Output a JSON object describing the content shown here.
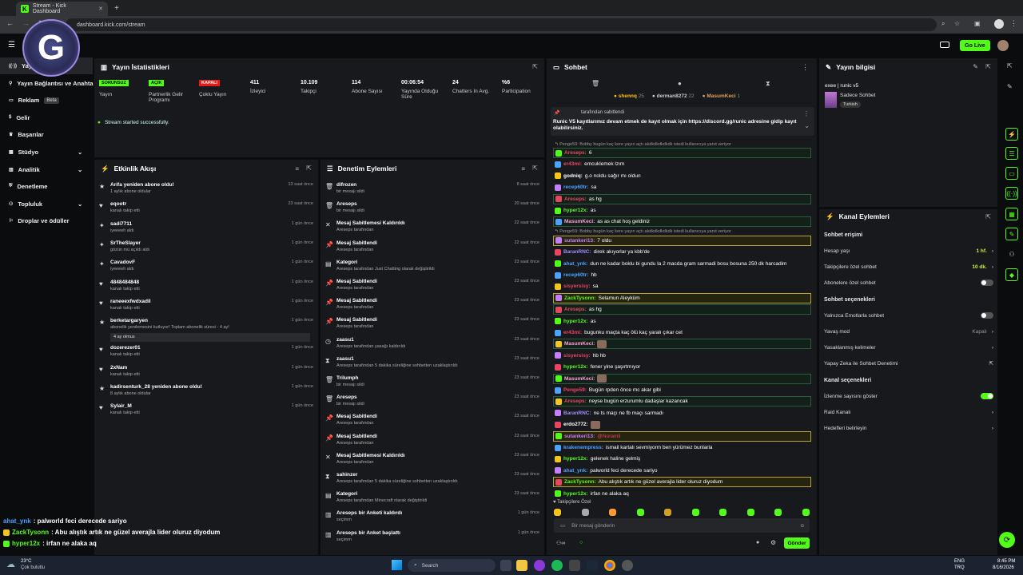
{
  "browser": {
    "tab_title": "Stream - Kick Dashboard",
    "url": "dashboard.kick.com/stream"
  },
  "app": {
    "go_live": "Go Live"
  },
  "nav": {
    "items": [
      {
        "label": "Yayın",
        "icon": "broadcast-icon"
      },
      {
        "label": "Yayın Bağlantısı ve Anahtarı",
        "icon": "link-icon"
      },
      {
        "label": "Reklam",
        "icon": "ad-icon",
        "badge": "Beta"
      },
      {
        "label": "Gelir",
        "icon": "dollar-icon"
      },
      {
        "label": "Başarılar",
        "icon": "trophy-icon"
      },
      {
        "label": "Stüdyo",
        "icon": "studio-icon"
      },
      {
        "label": "Analitik",
        "icon": "chart-icon"
      },
      {
        "label": "Denetleme",
        "icon": "shield-icon"
      },
      {
        "label": "Topluluk",
        "icon": "community-icon"
      },
      {
        "label": "Droplar ve ödüller",
        "icon": "gift-icon"
      }
    ]
  },
  "stats": {
    "title": "Yayın İstatistikleri",
    "items": [
      {
        "pill": "SORUNSUZ",
        "pill_color": "#53fc18",
        "label": "Yayın"
      },
      {
        "pill": "AÇIK",
        "pill_color": "#53fc18",
        "label": "Partnerlik Gelir Programı"
      },
      {
        "pill": "KAPALI",
        "pill_color": "#e91916",
        "label": "Çoklu Yayın"
      },
      {
        "value": "411",
        "label": "İzleyici"
      },
      {
        "value": "10.109",
        "label": "Takipçi"
      },
      {
        "value": "114",
        "label": "Abone Sayısı"
      },
      {
        "value": "00:06:54",
        "label": "Yayında Olduğu Süre"
      },
      {
        "value": "24",
        "label": "Chatters In Avg."
      },
      {
        "value": "%6",
        "label": "Participation"
      }
    ],
    "success": "Stream started successfully."
  },
  "activity": {
    "title": "Etkinlik Akışı",
    "events": [
      {
        "t": "Arifa yeniden abone oldu!",
        "s": "1 aylık abone oldular",
        "d": "13 saat önce",
        "icon": "★"
      },
      {
        "t": "eqootr",
        "s": "kanalı takip etti",
        "d": "23 saat önce",
        "icon": "♥"
      },
      {
        "t": "sadi7711",
        "s": "iyeeeeh aldı",
        "d": "1 gün önce",
        "icon": "✦"
      },
      {
        "t": "SrTheSlayer",
        "s": "gözün mü açıldı aldı",
        "d": "1 gün önce",
        "icon": "✦"
      },
      {
        "t": "CavadovF",
        "s": "iyeeeeh aldı",
        "d": "1 gün önce",
        "icon": "✦"
      },
      {
        "t": "4848484848",
        "s": "kanalı takip etti",
        "d": "1 gün önce",
        "icon": "♥"
      },
      {
        "t": "raneeexfwdxadil",
        "s": "kanalı takip etti",
        "d": "1 gün önce",
        "icon": "♥"
      },
      {
        "t": "berketargaryen",
        "s": "abonelik yenilemesini kutluyor! Toplam abonelik süresi - 4 ay!",
        "s2": "4 ay olmus",
        "d": "1 gün önce",
        "icon": "★"
      },
      {
        "t": "dozerezer01",
        "s": "kanalı takip etti",
        "d": "1 gün önce",
        "icon": "♥"
      },
      {
        "t": "2xNam",
        "s": "kanalı takip etti",
        "d": "1 gün önce",
        "icon": "♥"
      },
      {
        "t": "kadirsenturk_28 yeniden abone oldu!",
        "s": "8 aylık abone oldular",
        "d": "1 gün önce",
        "icon": "★"
      },
      {
        "t": "Sylair_M",
        "s": "kanalı takip etti",
        "d": "1 gün önce",
        "icon": "♥"
      }
    ]
  },
  "mod": {
    "title": "Denetim Eylemleri",
    "events": [
      {
        "t": "difrozen",
        "s": "bir mesajı sildi",
        "d": "8 saat önce",
        "icon": "🗑"
      },
      {
        "t": "Areseps",
        "s": "bir mesajı sildi",
        "d": "20 saat önce",
        "icon": "🗑"
      },
      {
        "t": "Mesaj Sabitlemesi Kaldırıldı",
        "s": "Areseps tarafından",
        "d": "22 saat önce",
        "icon": "✕"
      },
      {
        "t": "Mesaj Sabitlendi",
        "s": "Areseps tarafından",
        "d": "22 saat önce",
        "icon": "📌"
      },
      {
        "t": "Kategori",
        "s": "Areseps tarafından Just Chatting olarak değiştirildi",
        "d": "23 saat önce",
        "icon": "▤"
      },
      {
        "t": "Mesaj Sabitlendi",
        "s": "Areseps tarafından",
        "d": "23 saat önce",
        "icon": "📌"
      },
      {
        "t": "Mesaj Sabitlendi",
        "s": "Areseps tarafından",
        "d": "23 saat önce",
        "icon": "📌"
      },
      {
        "t": "Mesaj Sabitlendi",
        "s": "Areseps tarafından",
        "d": "23 saat önce",
        "icon": "📌"
      },
      {
        "t": "zaasu1",
        "s": "Areseps tarafından yasağı kaldırıldı",
        "d": "23 saat önce",
        "icon": "◷"
      },
      {
        "t": "zaasu1",
        "s": "Areseps tarafından 5 dakika süreliğine sohbetten uzaklaştırıldı",
        "d": "23 saat önce",
        "icon": "⧗"
      },
      {
        "t": "Trilumph",
        "s": "bir mesajı sildi",
        "d": "23 saat önce",
        "icon": "🗑"
      },
      {
        "t": "Areseps",
        "s": "bir mesajı sildi",
        "d": "23 saat önce",
        "icon": "🗑"
      },
      {
        "t": "Mesaj Sabitlendi",
        "s": "Areseps tarafından",
        "d": "23 saat önce",
        "icon": "📌"
      },
      {
        "t": "Mesaj Sabitlendi",
        "s": "Areseps tarafından",
        "d": "23 saat önce",
        "icon": "📌"
      },
      {
        "t": "Mesaj Sabitlemesi Kaldırıldı",
        "s": "Areseps tarafından",
        "d": "23 saat önce",
        "icon": "✕"
      },
      {
        "t": "sahinzer",
        "s": "Areseps tarafından 5 dakika süreliğine sohbetten uzaklaştırıldı",
        "d": "23 saat önce",
        "icon": "⧗"
      },
      {
        "t": "Kategori",
        "s": "Areseps tarafından Minecraft olarak değiştirildi",
        "d": "23 saat önce",
        "icon": "▤"
      },
      {
        "t": "Areseps bir Anketi kaldırdı",
        "s": "seçimm",
        "d": "1 gün önce",
        "icon": "▥"
      },
      {
        "t": "Areseps bir Anket başlattı",
        "s": "seçimm",
        "d": "1 gün önce",
        "icon": "▥"
      }
    ]
  },
  "chat": {
    "title": "Sohbet",
    "top_chatters": [
      {
        "name": "shennq",
        "n": "25",
        "color": "#f5c518"
      },
      {
        "name": "derman8272",
        "n": "22",
        "color": "#ccc"
      },
      {
        "name": "MasumKeci",
        "n": "1",
        "color": "#e0a060"
      }
    ],
    "pinned": {
      "by": "tarafından sabitlendi",
      "text": "Runic V5 kayıtlarımız devam etmek de kayıt olmak için https://discord.gg/runic adresine gidip kayıt olabilirsiniz."
    },
    "lines": [
      {
        "u": "Penge59: Bobby bugün kaç kere yayın açtı akdkdkdkdkdk istedi kullanıcıya yanıt veriyor",
        "c": "#999",
        "m": "",
        "type": "reply"
      },
      {
        "u": "Areseps",
        "c": "#e94560",
        "m": "6",
        "hl": "g"
      },
      {
        "u": "er43mi",
        "c": "#e94560",
        "m": "emcuklemek lzım"
      },
      {
        "u": "godniq",
        "c": "#fff",
        "m": "g.o noldu sağır mı oldun"
      },
      {
        "u": "recep60tr",
        "c": "#4aa3ff",
        "m": "sa"
      },
      {
        "u": "Areseps",
        "c": "#e94560",
        "m": "as hg",
        "hl": "g"
      },
      {
        "u": "hyper12x",
        "c": "#53fc18",
        "m": "as"
      },
      {
        "u": "MasumKeci",
        "c": "#ff9ed6",
        "m": "as as chat hoş geldiniz",
        "hl": "g"
      },
      {
        "u": "Penge59: Bobby bugün kaç kere yayın açtı akdkdkdkdkdk istedi kullanıcıya yanıt veriyor",
        "c": "#999",
        "m": "",
        "type": "reply"
      },
      {
        "u": "sutankeri13",
        "c": "#c77dff",
        "m": "7 oldu",
        "hl": "y"
      },
      {
        "u": "BaranRNC",
        "c": "#9b8cff",
        "m": "direk akıyorlar ya kbb'de"
      },
      {
        "u": "ahat_ynk",
        "c": "#4aa3ff",
        "m": "dun ne kadar boklu bi gundu la 2 macda gram sarmadi bosu bosuna 250 dk harcadim"
      },
      {
        "u": "recep60tr",
        "c": "#4aa3ff",
        "m": "hb"
      },
      {
        "u": "sisyersisy",
        "c": "#e94560",
        "m": "sa"
      },
      {
        "u": "ZackTysonn",
        "c": "#53fc18",
        "m": "Selamun Aleyküm",
        "hl": "y"
      },
      {
        "u": "Areseps",
        "c": "#e94560",
        "m": "as hg",
        "hl": "g"
      },
      {
        "u": "hyper12x",
        "c": "#53fc18",
        "m": "as"
      },
      {
        "u": "er43mi",
        "c": "#e94560",
        "m": "bugunku maçta kaç ölü kaç yaralı çıkar cet"
      },
      {
        "u": "MasumKeci",
        "c": "#ff9ed6",
        "m": "[emote]",
        "hl": "g"
      },
      {
        "u": "sisyersisy",
        "c": "#e94560",
        "m": "hb hb"
      },
      {
        "u": "hyper12x",
        "c": "#53fc18",
        "m": "fener yine şaşırtmıyor"
      },
      {
        "u": "MasumKeci",
        "c": "#ff9ed6",
        "m": "[emote]",
        "hl": "g"
      },
      {
        "u": "Penge59",
        "c": "#e94560",
        "m": "Bugün rpden önce mc akar gibi"
      },
      {
        "u": "Areseps",
        "c": "#e94560",
        "m": "neyse bugün erzurumlu dadaşlar kazancak",
        "hl": "g"
      },
      {
        "u": "BaranRNC",
        "c": "#9b8cff",
        "m": "ne ts maçı ne fb maçı sarmadı"
      },
      {
        "u": "erdo2772",
        "c": "#fff",
        "m": "[emote]"
      },
      {
        "u": "sutankeri13",
        "c": "#c77dff",
        "m": "@Noramli",
        "hl": "y"
      },
      {
        "u": "krakenempress",
        "c": "#4aa3ff",
        "m": "ismail kartalı sevmiyorm ben yürümez bunlarla"
      },
      {
        "u": "hyper12x",
        "c": "#53fc18",
        "m": "gelenek haline gelmiş"
      },
      {
        "u": "ahat_ynk",
        "c": "#4aa3ff",
        "m": "palworld feci derecede sariyo"
      },
      {
        "u": "ZackTysonn",
        "c": "#53fc18",
        "m": "Abu alıştık artık ne güzel averajla lider oluruz diyodum",
        "hl": "y"
      },
      {
        "u": "hyper12x",
        "c": "#53fc18",
        "m": "irfan ne alaka aq"
      }
    ],
    "followers_only": "Takipçilere Özel",
    "input_placeholder": "Bir mesaj gönderin",
    "send": "Gönder"
  },
  "info": {
    "title": "Yayın bilgisi",
    "stream_title": "exee | runic v5",
    "category": "Sadece Sohbet",
    "tag": "Turkish"
  },
  "channel": {
    "title": "Kanal Eylemleri",
    "chat_access": "Sohbet erişimi",
    "rows1": [
      {
        "l": "Hesap yaşı",
        "v": "1 hf."
      },
      {
        "l": "Takipçilere özel sohbet",
        "v": "10 dk."
      },
      {
        "l": "Abonelere özel sohbet",
        "toggle": false
      }
    ],
    "chat_options": "Sohbet seçenekleri",
    "rows2": [
      {
        "l": "Yalnızca Emotlarla sohbet",
        "toggle": false
      },
      {
        "l": "Yavaş mod",
        "v": "Kapalı"
      },
      {
        "l": "Yasaklanmış kelimeler"
      },
      {
        "l": "Yapay Zeka ile Sohbet Denetimi"
      }
    ],
    "channel_options": "Kanal seçenekleri",
    "rows3": [
      {
        "l": "İzlenme sayısını göster",
        "toggle": true
      },
      {
        "l": "Raid Kanalı"
      },
      {
        "l": "Hedefleri belirleyin"
      }
    ]
  },
  "overlay": {
    "lines": [
      {
        "u": "ahat_ynk",
        "c": "#4aa3ff",
        "m": ": palworld feci derecede sariyo"
      },
      {
        "u": "ZackTysonn",
        "c": "#53fc18",
        "m": ": Abu alıştık artık ne güzel averajla lider oluruz diyodum"
      },
      {
        "u": "hyper12x",
        "c": "#53fc18",
        "m": ": irfan ne alaka aq"
      }
    ]
  },
  "taskbar": {
    "temp": "23°C",
    "weather": "Çok bulutlu",
    "search": "Search",
    "lang1": "ENG",
    "lang2": "TRQ",
    "time": "8:45 PM",
    "date": "8/16/2026"
  }
}
